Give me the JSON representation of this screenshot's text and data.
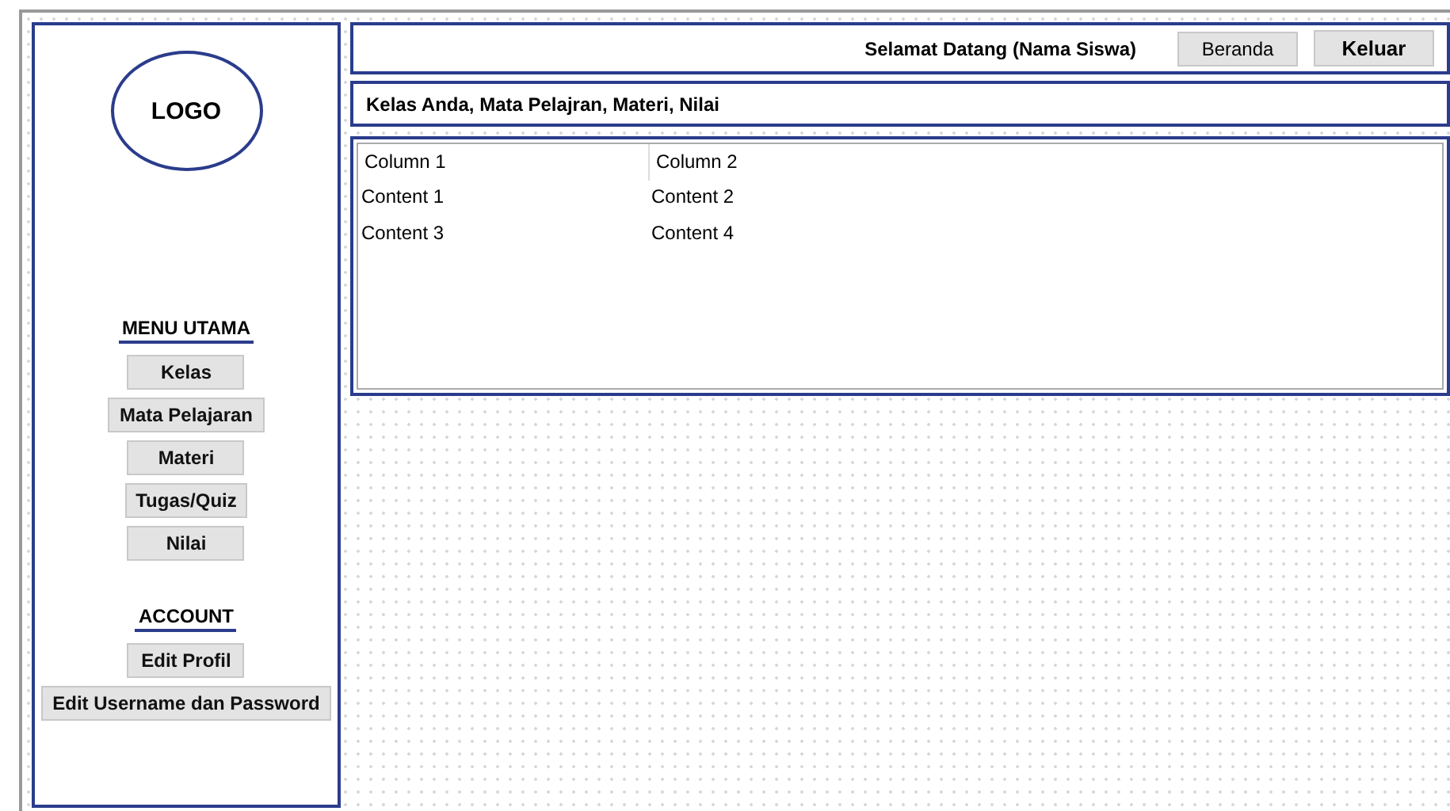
{
  "sidebar": {
    "logo": "LOGO",
    "sections": [
      {
        "heading": "MENU UTAMA",
        "items": [
          "Kelas",
          "Mata Pelajaran",
          "Materi",
          "Tugas/Quiz",
          "Nilai"
        ]
      },
      {
        "heading": "ACCOUNT",
        "items": [
          "Edit Profil",
          "Edit Username dan Password"
        ]
      }
    ]
  },
  "header": {
    "welcome": "Selamat Datang (Nama Siswa)",
    "buttons": [
      {
        "label": "Beranda",
        "bold": false
      },
      {
        "label": "Keluar",
        "bold": true
      }
    ]
  },
  "title_bar": "Kelas Anda, Mata Pelajran, Materi, Nilai",
  "table": {
    "columns": [
      "Column 1",
      "Column 2"
    ],
    "rows": [
      [
        "Content 1",
        "Content 2"
      ],
      [
        "Content 3",
        "Content 4"
      ]
    ]
  }
}
